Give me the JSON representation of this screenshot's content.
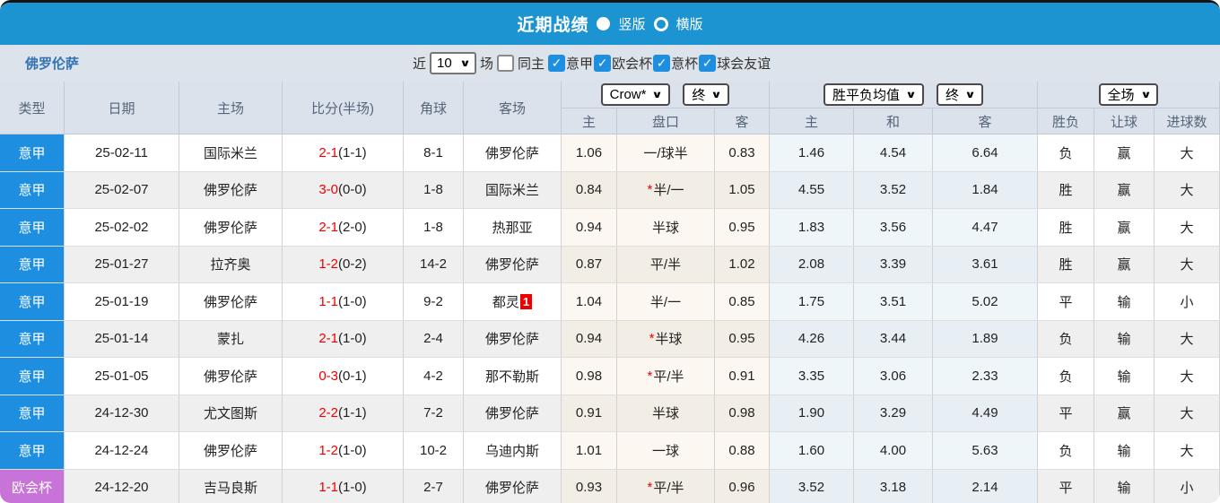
{
  "title_bar": {
    "title": "近期战绩",
    "radios": [
      {
        "label": "竖版",
        "selected": true
      },
      {
        "label": "横版",
        "selected": false
      }
    ]
  },
  "filter_bar": {
    "team": "佛罗伦萨",
    "recent_label": "近",
    "count_value": "10",
    "matches_label": "场",
    "same_home": {
      "label": "同主",
      "checked": false
    },
    "league_filters": [
      {
        "label": "意甲",
        "checked": true
      },
      {
        "label": "欧会杯",
        "checked": true
      },
      {
        "label": "意杯",
        "checked": true
      },
      {
        "label": "球会友谊",
        "checked": true
      }
    ]
  },
  "table": {
    "left_headers": [
      "类型",
      "日期",
      "主场",
      "比分(半场)",
      "角球",
      "客场"
    ],
    "dropdowns": {
      "odds_company": "Crow*",
      "odds_stage": "终",
      "avg_label": "胜平负均值",
      "avg_stage": "终",
      "scope": "全场"
    },
    "sub_headers": [
      "主",
      "盘口",
      "客",
      "主",
      "和",
      "客",
      "胜负",
      "让球",
      "进球数"
    ],
    "rows": [
      {
        "type": "意甲",
        "date": "25-02-11",
        "home": "国际米兰",
        "score": "2-1",
        "half": "(1-1)",
        "corner": "8-1",
        "away": "佛罗伦萨",
        "away_badge": "",
        "odds_home": "1.06",
        "handicap_star": false,
        "handicap": "一/球半",
        "odds_away": "0.83",
        "avg_home": "1.46",
        "avg_draw": "4.54",
        "avg_away": "6.64",
        "wdl": "负",
        "handicap_result": "赢",
        "goals": "大"
      },
      {
        "type": "意甲",
        "date": "25-02-07",
        "home": "佛罗伦萨",
        "score": "3-0",
        "half": "(0-0)",
        "corner": "1-8",
        "away": "国际米兰",
        "away_badge": "",
        "odds_home": "0.84",
        "handicap_star": true,
        "handicap": "半/一",
        "odds_away": "1.05",
        "avg_home": "4.55",
        "avg_draw": "3.52",
        "avg_away": "1.84",
        "wdl": "胜",
        "handicap_result": "赢",
        "goals": "大"
      },
      {
        "type": "意甲",
        "date": "25-02-02",
        "home": "佛罗伦萨",
        "score": "2-1",
        "half": "(2-0)",
        "corner": "1-8",
        "away": "热那亚",
        "away_badge": "",
        "odds_home": "0.94",
        "handicap_star": false,
        "handicap": "半球",
        "odds_away": "0.95",
        "avg_home": "1.83",
        "avg_draw": "3.56",
        "avg_away": "4.47",
        "wdl": "胜",
        "handicap_result": "赢",
        "goals": "大"
      },
      {
        "type": "意甲",
        "date": "25-01-27",
        "home": "拉齐奥",
        "score": "1-2",
        "half": "(0-2)",
        "corner": "14-2",
        "away": "佛罗伦萨",
        "away_badge": "",
        "odds_home": "0.87",
        "handicap_star": false,
        "handicap": "平/半",
        "odds_away": "1.02",
        "avg_home": "2.08",
        "avg_draw": "3.39",
        "avg_away": "3.61",
        "wdl": "胜",
        "handicap_result": "赢",
        "goals": "大"
      },
      {
        "type": "意甲",
        "date": "25-01-19",
        "home": "佛罗伦萨",
        "score": "1-1",
        "half": "(1-0)",
        "corner": "9-2",
        "away": "都灵",
        "away_badge": "1",
        "odds_home": "1.04",
        "handicap_star": false,
        "handicap": "半/一",
        "odds_away": "0.85",
        "avg_home": "1.75",
        "avg_draw": "3.51",
        "avg_away": "5.02",
        "wdl": "平",
        "handicap_result": "输",
        "goals": "小"
      },
      {
        "type": "意甲",
        "date": "25-01-14",
        "home": "蒙扎",
        "score": "2-1",
        "half": "(1-0)",
        "corner": "2-4",
        "away": "佛罗伦萨",
        "away_badge": "",
        "odds_home": "0.94",
        "handicap_star": true,
        "handicap": "半球",
        "odds_away": "0.95",
        "avg_home": "4.26",
        "avg_draw": "3.44",
        "avg_away": "1.89",
        "wdl": "负",
        "handicap_result": "输",
        "goals": "大"
      },
      {
        "type": "意甲",
        "date": "25-01-05",
        "home": "佛罗伦萨",
        "score": "0-3",
        "half": "(0-1)",
        "corner": "4-2",
        "away": "那不勒斯",
        "away_badge": "",
        "odds_home": "0.98",
        "handicap_star": true,
        "handicap": "平/半",
        "odds_away": "0.91",
        "avg_home": "3.35",
        "avg_draw": "3.06",
        "avg_away": "2.33",
        "wdl": "负",
        "handicap_result": "输",
        "goals": "大"
      },
      {
        "type": "意甲",
        "date": "24-12-30",
        "home": "尤文图斯",
        "score": "2-2",
        "half": "(1-1)",
        "corner": "7-2",
        "away": "佛罗伦萨",
        "away_badge": "",
        "odds_home": "0.91",
        "handicap_star": false,
        "handicap": "半球",
        "odds_away": "0.98",
        "avg_home": "1.90",
        "avg_draw": "3.29",
        "avg_away": "4.49",
        "wdl": "平",
        "handicap_result": "赢",
        "goals": "大"
      },
      {
        "type": "意甲",
        "date": "24-12-24",
        "home": "佛罗伦萨",
        "score": "1-2",
        "half": "(1-0)",
        "corner": "10-2",
        "away": "乌迪内斯",
        "away_badge": "",
        "odds_home": "1.01",
        "handicap_star": false,
        "handicap": "一球",
        "odds_away": "0.88",
        "avg_home": "1.60",
        "avg_draw": "4.00",
        "avg_away": "5.63",
        "wdl": "负",
        "handicap_result": "输",
        "goals": "大"
      },
      {
        "type": "欧会杯",
        "date": "24-12-20",
        "home": "吉马良斯",
        "score": "1-1",
        "half": "(1-0)",
        "corner": "2-7",
        "away": "佛罗伦萨",
        "away_badge": "",
        "odds_home": "0.93",
        "handicap_star": true,
        "handicap": "平/半",
        "odds_away": "0.96",
        "avg_home": "3.52",
        "avg_draw": "3.18",
        "avg_away": "2.14",
        "wdl": "平",
        "handicap_result": "输",
        "goals": "小"
      }
    ]
  },
  "colors": {
    "titlebar_blue": "#1c94d2",
    "checkbox_blue": "#1e8fe0",
    "score_red": "#f00000",
    "highlight_team_green": "#4e9c50",
    "team_navy": "#36455f",
    "handicap_blue": "#6a6acd",
    "avg_draw_blue": "#3766c8",
    "type_colors": {
      "意甲": "#1e8fe0",
      "欧会杯": "#c873d8"
    },
    "result_colors": {
      "胜": "red",
      "负": "green",
      "平": "blue",
      "赢": "red",
      "输": "green",
      "大": "red",
      "小": "green"
    }
  }
}
